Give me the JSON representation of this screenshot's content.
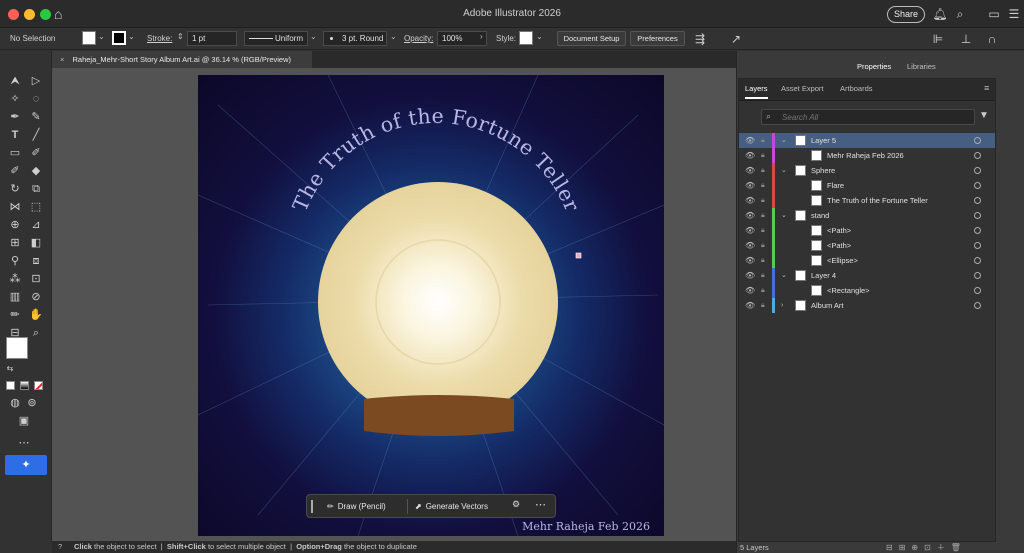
{
  "window": {
    "title": "Adobe Illustrator 2026",
    "share_label": "Share",
    "colors": {
      "close": "#ff5f57",
      "minimize": "#febc2e",
      "zoom": "#28c840"
    }
  },
  "control_bar": {
    "selection": "No Selection",
    "stroke_label": "Stroke:",
    "stroke_value": "1 pt",
    "stroke_profile": "Uniform",
    "brush": "3 pt. Round",
    "opacity_label": "Opacity:",
    "opacity_value": "100%",
    "style_label": "Style:",
    "document_setup": "Document Setup",
    "preferences": "Preferences"
  },
  "document_tab": {
    "title": "Raheja_Mehr-Short Story Album Art.ai @ 36.14 % (RGB/Preview)"
  },
  "artwork": {
    "curved_title": "The Truth of the Fortune Teller",
    "signature": "Mehr Raheja Feb 2026",
    "colors": {
      "globe": "#e8d7a3",
      "stand": "#7b4a21",
      "title": "#b9b6e6"
    }
  },
  "contextual_bar": {
    "draw_label": "Draw (Pencil)",
    "generate_label": "Generate Vectors"
  },
  "panel_tabs": {
    "properties": "Properties",
    "libraries": "Libraries"
  },
  "layers_panel": {
    "tabs": [
      "Layers",
      "Asset Export",
      "Artboards"
    ],
    "search_placeholder": "Search All",
    "rows": [
      {
        "name": "Layer 5",
        "color": "#c34ad8",
        "indent": 0,
        "twisty": "v",
        "selected": true
      },
      {
        "name": "Mehr Raheja Feb 2026",
        "color": "#c34ad8",
        "indent": 1,
        "twisty": "",
        "selected": false
      },
      {
        "name": "Sphere",
        "color": "#d8484a",
        "indent": 0,
        "twisty": "v",
        "selected": false
      },
      {
        "name": "Flare",
        "color": "#d8484a",
        "indent": 1,
        "twisty": "",
        "selected": false
      },
      {
        "name": "The Truth of the Fortune Teller",
        "color": "#d8484a",
        "indent": 1,
        "twisty": "",
        "selected": false
      },
      {
        "name": "stand",
        "color": "#59c95a",
        "indent": 0,
        "twisty": "v",
        "selected": false
      },
      {
        "name": "<Path>",
        "color": "#59c95a",
        "indent": 1,
        "twisty": "",
        "selected": false
      },
      {
        "name": "<Path>",
        "color": "#59c95a",
        "indent": 1,
        "twisty": "",
        "selected": false
      },
      {
        "name": "<Ellipse>",
        "color": "#59c95a",
        "indent": 1,
        "twisty": "",
        "selected": false
      },
      {
        "name": "Layer 4",
        "color": "#4f6ad9",
        "indent": 0,
        "twisty": "v",
        "selected": false
      },
      {
        "name": "<Rectangle>",
        "color": "#4f6ad9",
        "indent": 1,
        "twisty": "",
        "selected": false
      },
      {
        "name": "Album Art",
        "color": "#4fa9d9",
        "indent": 0,
        "twisty": ">",
        "selected": false
      }
    ],
    "footer": "5 Layers"
  },
  "status_bar": {
    "click_key": "Click",
    "click_text": "the object to select",
    "shift_key": "Shift+Click",
    "shift_text": "to select multiple object",
    "option_key": "Option+Drag",
    "option_text": "the object to duplicate"
  }
}
